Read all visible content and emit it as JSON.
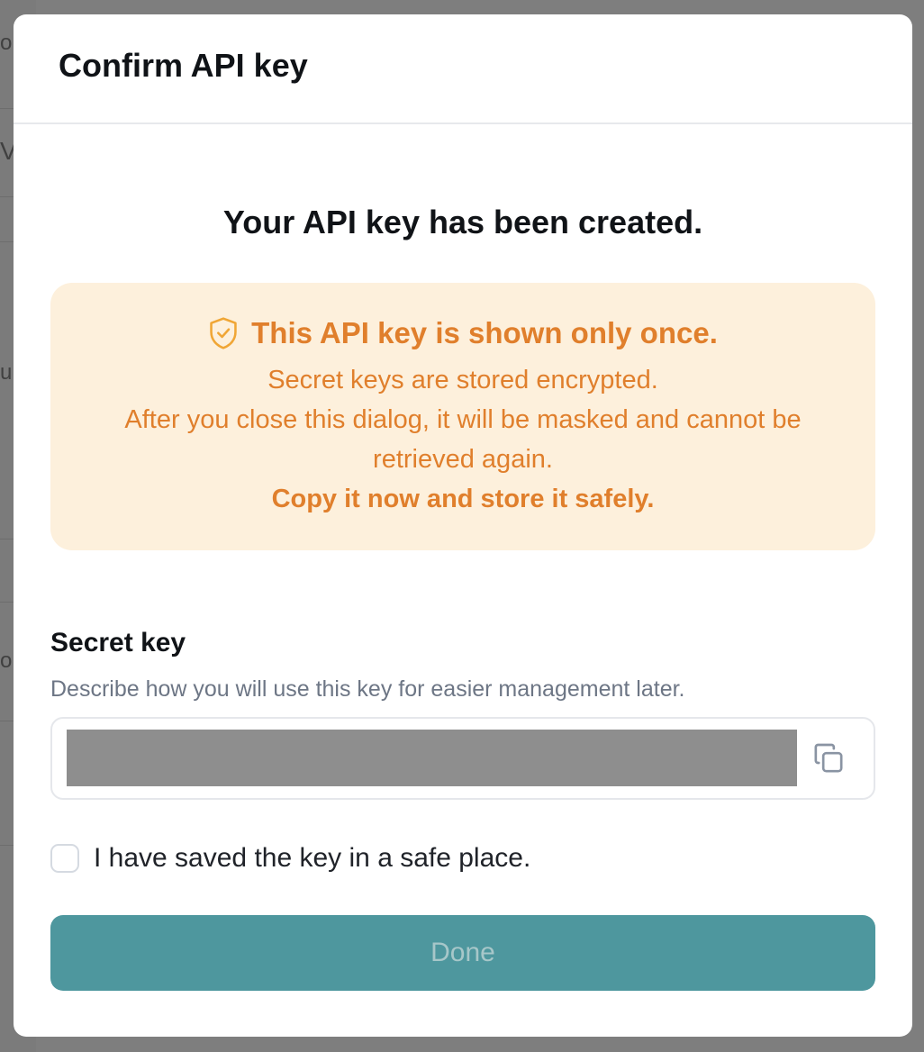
{
  "dialog": {
    "title": "Confirm API key",
    "headline": "Your API key has been created.",
    "warning": {
      "title": "This API key is shown only once.",
      "lines": [
        "Secret keys are stored encrypted.",
        "After you close this dialog, it will be masked and cannot be",
        "retrieved again."
      ],
      "emphasis": "Copy it now and store it safely.",
      "icon": "shield-check-icon",
      "color": "#e07f2c",
      "background": "#fdf0dc"
    },
    "secret_key": {
      "label": "Secret key",
      "help": "Describe how you will use this key for easier management later.",
      "copy_icon": "copy-icon"
    },
    "confirmation": {
      "label": "I have saved the key in a safe place.",
      "checked": false
    },
    "done_button": {
      "label": "Done",
      "disabled": true,
      "color": "#4e979e"
    }
  },
  "background": {
    "fragments": [
      "o",
      "V",
      "u",
      "o"
    ]
  }
}
